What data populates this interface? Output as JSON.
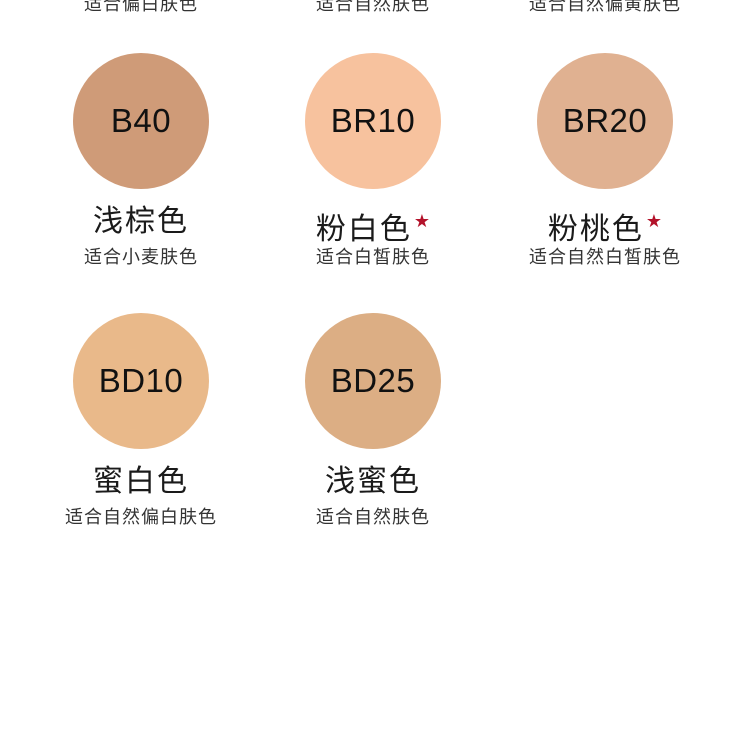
{
  "top_row": [
    {
      "desc": "适合偏白肤色"
    },
    {
      "desc": "适合自然肤色"
    },
    {
      "desc": "适合自然偏黄肤色"
    }
  ],
  "shades": [
    {
      "code": "B40",
      "name": "浅棕色",
      "desc": "适合小麦肤色",
      "starred": false,
      "color": "#cf9b78"
    },
    {
      "code": "BR10",
      "name": "粉白色",
      "desc": "适合白皙肤色",
      "starred": true,
      "color": "#f7c29e"
    },
    {
      "code": "BR20",
      "name": "粉桃色",
      "desc": "适合自然白皙肤色",
      "starred": true,
      "color": "#e0b191"
    },
    {
      "code": "BD10",
      "name": "蜜白色",
      "desc": "适合自然偏白肤色",
      "starred": false,
      "color": "#e9b98a"
    },
    {
      "code": "BD25",
      "name": "浅蜜色",
      "desc": "适合自然肤色",
      "starred": false,
      "color": "#dcae84"
    }
  ],
  "star_glyph": "★",
  "star_color": "#b3122a"
}
